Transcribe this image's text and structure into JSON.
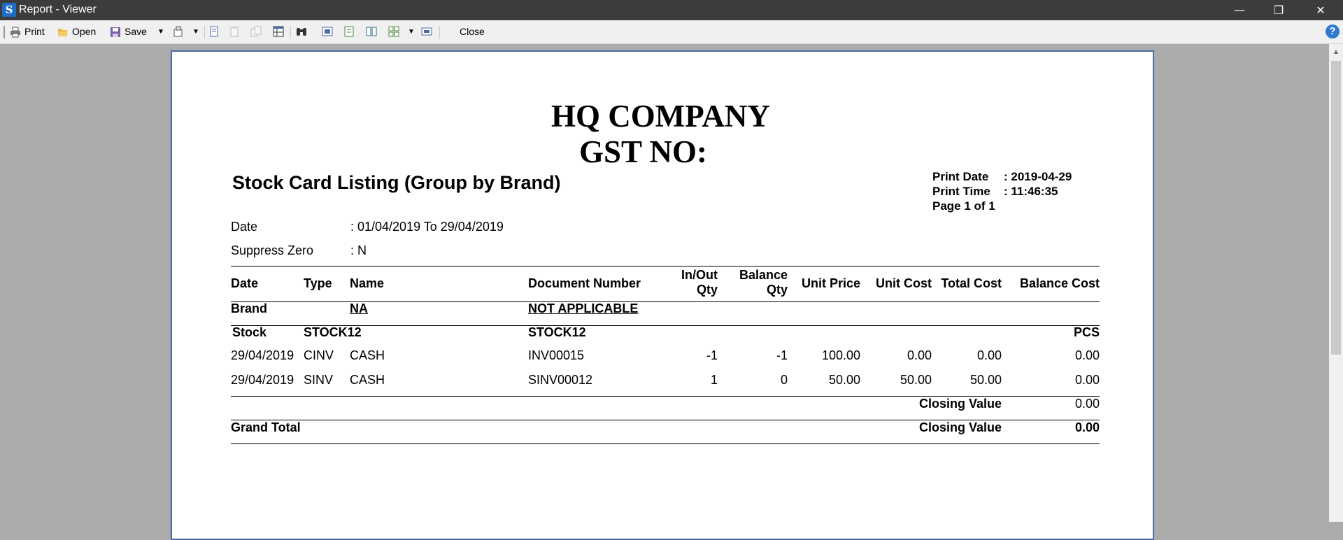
{
  "window": {
    "title": "Report - Viewer",
    "minimize": "—",
    "restore": "❐",
    "close": "✕"
  },
  "toolbar": {
    "print_label": "Print",
    "open_label": "Open",
    "save_label": "Save",
    "close_label": "Close",
    "help_label": "?"
  },
  "report": {
    "company": "HQ COMPANY",
    "gst": "GST NO:",
    "title": "Stock Card Listing (Group by Brand)",
    "print_date_label": "Print Date",
    "print_date_value": ": 2019-04-29",
    "print_time_label": "Print Time",
    "print_time_value": ": 11:46:35",
    "page_label": "Page 1 of 1",
    "filters": [
      {
        "label": "Date",
        "value": ": 01/04/2019 To 29/04/2019"
      },
      {
        "label": "Suppress Zero",
        "value": ": N"
      }
    ],
    "columns": {
      "date": "Date",
      "type": "Type",
      "name": "Name",
      "doc": "Document Number",
      "inout1": "In/Out",
      "inout2": "Qty",
      "bal1": "Balance",
      "bal2": "Qty",
      "unit_price": "Unit Price",
      "unit_cost": "Unit Cost",
      "total_cost": "Total Cost",
      "balance_cost": "Balance Cost"
    },
    "brand": {
      "label": "Brand",
      "code": "NA",
      "name": "NOT APPLICABLE"
    },
    "stock": {
      "label": "Stock",
      "code": "STOCK12",
      "name": "STOCK12",
      "uom": "PCS"
    },
    "rows": [
      {
        "date": "29/04/2019",
        "type": "CINV",
        "name": "CASH",
        "doc": "INV00015",
        "inout": "-1",
        "bal": "-1",
        "unit_price": "100.00",
        "unit_cost": "0.00",
        "total_cost": "0.00",
        "balance_cost": "0.00"
      },
      {
        "date": "29/04/2019",
        "type": "SINV",
        "name": "CASH",
        "doc": "SINV00012",
        "inout": "1",
        "bal": "0",
        "unit_price": "50.00",
        "unit_cost": "50.00",
        "total_cost": "50.00",
        "balance_cost": "0.00"
      }
    ],
    "closing_label": "Closing Value",
    "closing_value": "0.00",
    "grand_total_label": "Grand Total",
    "grand_closing_label": "Closing Value",
    "grand_closing_value": "0.00"
  }
}
